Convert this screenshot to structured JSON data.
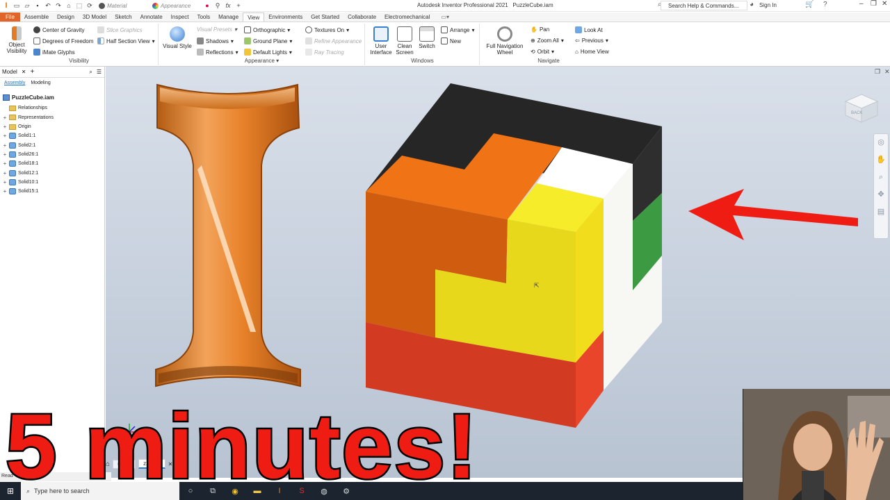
{
  "titlebar": {
    "app_title": "Autodesk Inventor Professional 2021",
    "file_name": "PuzzleCube.iam",
    "material_field": "Material",
    "appearance_field": "Appearance",
    "help_search": "Search Help & Commands...",
    "sign_in": "Sign In"
  },
  "tabs": [
    {
      "label": "File"
    },
    {
      "label": "Assemble"
    },
    {
      "label": "Design"
    },
    {
      "label": "3D Model"
    },
    {
      "label": "Sketch"
    },
    {
      "label": "Annotate"
    },
    {
      "label": "Inspect"
    },
    {
      "label": "Tools"
    },
    {
      "label": "Manage"
    },
    {
      "label": "View"
    },
    {
      "label": "Environments"
    },
    {
      "label": "Get Started"
    },
    {
      "label": "Collaborate"
    },
    {
      "label": "Electromechanical"
    }
  ],
  "ribbon": {
    "visibility": {
      "title": "Visibility",
      "object_visibility": "Object Visibility",
      "center_of_gravity": "Center of Gravity",
      "degrees_of_freedom": "Degrees of Freedom",
      "imate_glyphs": "iMate Glyphs",
      "slice_graphics": "Slice Graphics",
      "half_section_view": "Half Section View"
    },
    "appearance": {
      "title": "Appearance",
      "visual_style": "Visual Style",
      "visual_presets": "Visual Presets",
      "shadows": "Shadows",
      "reflections": "Reflections",
      "orthographic": "Orthographic",
      "ground_plane": "Ground Plane",
      "default_lights": "Default Lights",
      "textures_on": "Textures On",
      "refine_appearance": "Refine Appearance",
      "ray_tracing": "Ray Tracing"
    },
    "windows": {
      "title": "Windows",
      "user_interface": "User Interface",
      "clean_screen": "Clean Screen",
      "switch": "Switch",
      "arrange": "Arrange",
      "new": "New"
    },
    "navigate": {
      "title": "Navigate",
      "full_navigation_wheel": "Full Navigation Wheel",
      "pan": "Pan",
      "zoom_all": "Zoom All",
      "orbit": "Orbit",
      "look_at": "Look At",
      "previous": "Previous",
      "home_view": "Home View"
    }
  },
  "browser": {
    "header": "Model",
    "tabs": [
      "Assembly",
      "Modeling"
    ],
    "root": "PuzzleCube.iam",
    "folders": [
      "Relationships",
      "Representations",
      "Origin"
    ],
    "parts": [
      "Solid1:1",
      "Solid2:1",
      "Solid26:1",
      "Solid18:1",
      "Solid12:1",
      "Solid10:1",
      "Solid15:1"
    ]
  },
  "viewport": {
    "viewcube_label": "BACK"
  },
  "doc_tabs": [
    "Cube",
    "zzleCu"
  ],
  "status_text": "Read",
  "taskbar": {
    "search_placeholder": "Type here to search"
  },
  "overlay": {
    "headline": "5 minutes!"
  },
  "colors": {
    "file_tab": "#e1652b",
    "cube_orange": "#f07316",
    "cube_yellow": "#f6e21b",
    "cube_red": "#d23a22",
    "cube_black": "#262626",
    "cube_green": "#3c9a43",
    "arrow": "#ee1c12"
  }
}
